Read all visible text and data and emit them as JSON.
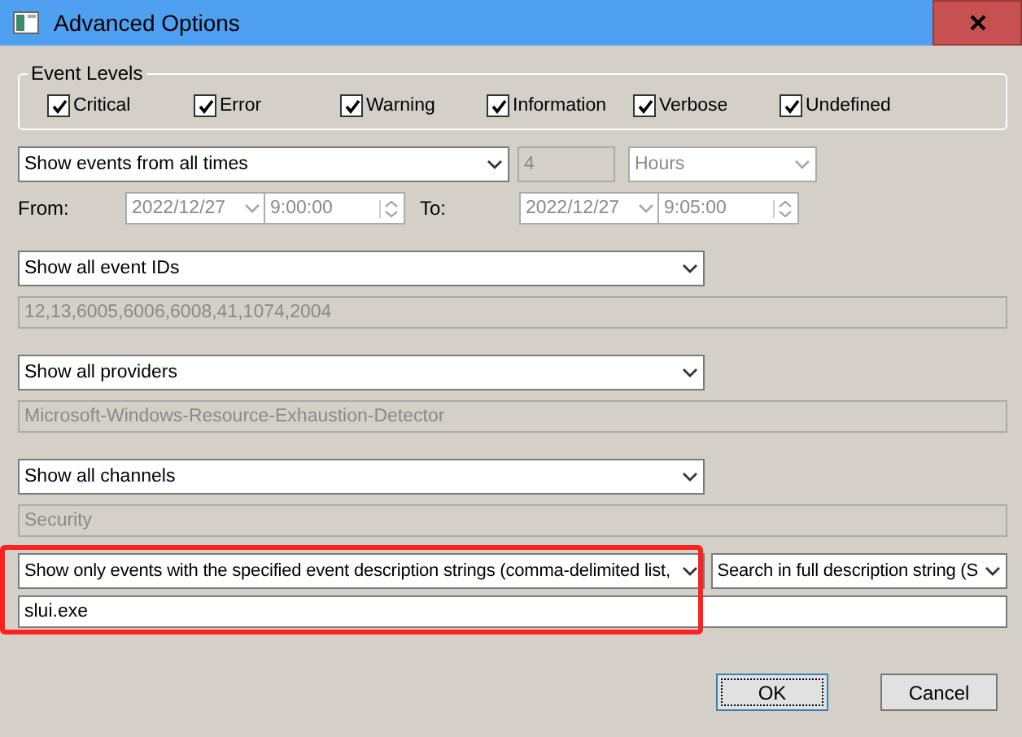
{
  "window": {
    "title": "Advanced Options"
  },
  "event_levels": {
    "title": "Event Levels",
    "levels": [
      {
        "label": "Critical",
        "checked": true
      },
      {
        "label": "Error",
        "checked": true
      },
      {
        "label": "Warning",
        "checked": true
      },
      {
        "label": "Information",
        "checked": true
      },
      {
        "label": "Verbose",
        "checked": true
      },
      {
        "label": "Undefined",
        "checked": true
      }
    ]
  },
  "time_filter": {
    "range": {
      "value": "Show events from all times",
      "disabled": false
    },
    "count": {
      "value": "4",
      "disabled": true
    },
    "unit": {
      "value": "Hours",
      "disabled": true
    },
    "from": {
      "label": "From:",
      "date": "2022/12/27",
      "time": "9:00:00",
      "disabled": true
    },
    "to": {
      "label": "To:",
      "date": "2022/12/27",
      "time": "9:05:00",
      "disabled": true
    }
  },
  "filters": [
    {
      "mode": "Show all event IDs",
      "value": "12,13,6005,6006,6008,41,1074,2004",
      "disabled": true
    },
    {
      "mode": "Show all providers",
      "value": "Microsoft-Windows-Resource-Exhaustion-Detector",
      "disabled": true
    },
    {
      "mode": "Show all channels",
      "value": "Security",
      "disabled": true
    },
    {
      "mode": "Show only events with the specified event description strings (comma-delimited list,",
      "option": "Search in full description string (S",
      "value": "slui.exe",
      "disabled": false,
      "highlighted": true
    }
  ],
  "buttons": [
    {
      "label": "OK",
      "focused": true
    },
    {
      "label": "Cancel",
      "focused": false
    }
  ]
}
